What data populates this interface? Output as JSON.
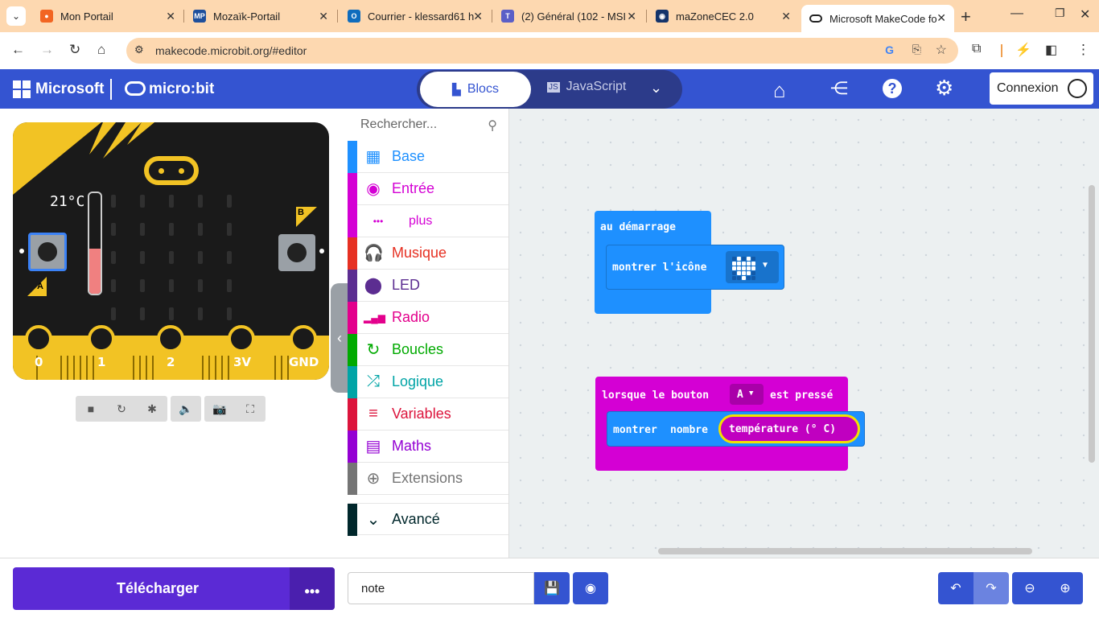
{
  "browser": {
    "tabs": [
      {
        "title": "Mon Portail",
        "fav": "M",
        "favcolor": "#fdd8b0"
      },
      {
        "title": "Mozaïk-Portail",
        "fav": "MP",
        "favcolor": "#1e4f9c"
      },
      {
        "title": "Courrier - klessard61 h",
        "fav": "O",
        "favcolor": "#0f6cbd"
      },
      {
        "title": "(2) Général (102 - MSI",
        "fav": "T",
        "favcolor": "#5b5fc7"
      },
      {
        "title": "maZoneCEC 2.0",
        "fav": "C",
        "favcolor": "#14346b"
      },
      {
        "title": "Microsoft MakeCode fo",
        "fav": "∞",
        "favcolor": "#ffffff"
      }
    ],
    "url": "makecode.microbit.org/#editor"
  },
  "header": {
    "brand": "Microsoft",
    "product": "micro:bit",
    "blocks_tab": "Blocs",
    "js_tab": "JavaScript",
    "connexion": "Connexion"
  },
  "simulator": {
    "temperature": "21°C",
    "button_a": "A",
    "button_b": "B",
    "pins": [
      "0",
      "1",
      "2",
      "3V",
      "GND"
    ],
    "thermo_level": 0.45
  },
  "toolbox": {
    "search_placeholder": "Rechercher...",
    "categories": [
      {
        "label": "Base",
        "color": "#1e90ff",
        "icon": "grid-icon"
      },
      {
        "label": "Entrée",
        "color": "#d400d4",
        "icon": "target-icon"
      },
      {
        "label": "plus",
        "color": "#d400d4",
        "icon": "more-icon"
      },
      {
        "label": "Musique",
        "color": "#e63022",
        "icon": "headphones-icon"
      },
      {
        "label": "LED",
        "color": "#5c2d91",
        "icon": "toggle-icon"
      },
      {
        "label": "Radio",
        "color": "#e3008c",
        "icon": "signal-icon"
      },
      {
        "label": "Boucles",
        "color": "#00aa00",
        "icon": "loop-icon"
      },
      {
        "label": "Logique",
        "color": "#00a4a6",
        "icon": "shuffle-icon"
      },
      {
        "label": "Variables",
        "color": "#dc143c",
        "icon": "list-icon"
      },
      {
        "label": "Maths",
        "color": "#9400d3",
        "icon": "calculator-icon"
      },
      {
        "label": "Extensions",
        "color": "#757575",
        "icon": "plus-circle-icon"
      },
      {
        "label": "Avancé",
        "color": "#00272b",
        "icon": "chevron-down-icon"
      }
    ]
  },
  "blocks": {
    "on_start": "au démarrage",
    "show_icon": "montrer l'icône",
    "on_button": "lorsque le bouton",
    "button_value": "A",
    "pressed": "est pressé",
    "show": "montrer",
    "number": "nombre",
    "temperature": "température (° C)"
  },
  "footer": {
    "download": "Télécharger",
    "more": "•••",
    "project_name": "note"
  }
}
